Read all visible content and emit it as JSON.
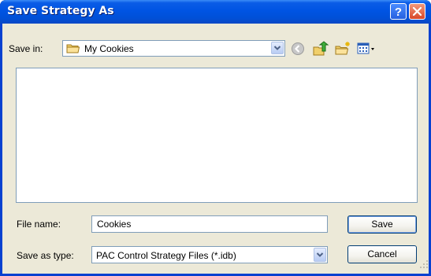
{
  "window": {
    "title": "Save Strategy As"
  },
  "toolbar": {
    "save_in_label": "Save in:",
    "location": "My Cookies"
  },
  "form": {
    "file_name_label": "File name:",
    "file_name_value": "Cookies",
    "save_as_type_label": "Save as type:",
    "save_as_type_value": "PAC Control Strategy Files (*.idb)"
  },
  "buttons": {
    "save_label": "Save",
    "cancel_label": "Cancel"
  },
  "icons": {
    "help": "help-icon",
    "close": "close-icon",
    "folder": "folder-icon",
    "back": "back-icon",
    "up": "up-folder-icon",
    "new_folder": "new-folder-icon",
    "views": "views-menu-icon"
  },
  "colors": {
    "title_bar": "#0054e3",
    "dialog_bg": "#ece9d8",
    "close_button": "#d8482a",
    "field_border": "#7f9db9"
  }
}
